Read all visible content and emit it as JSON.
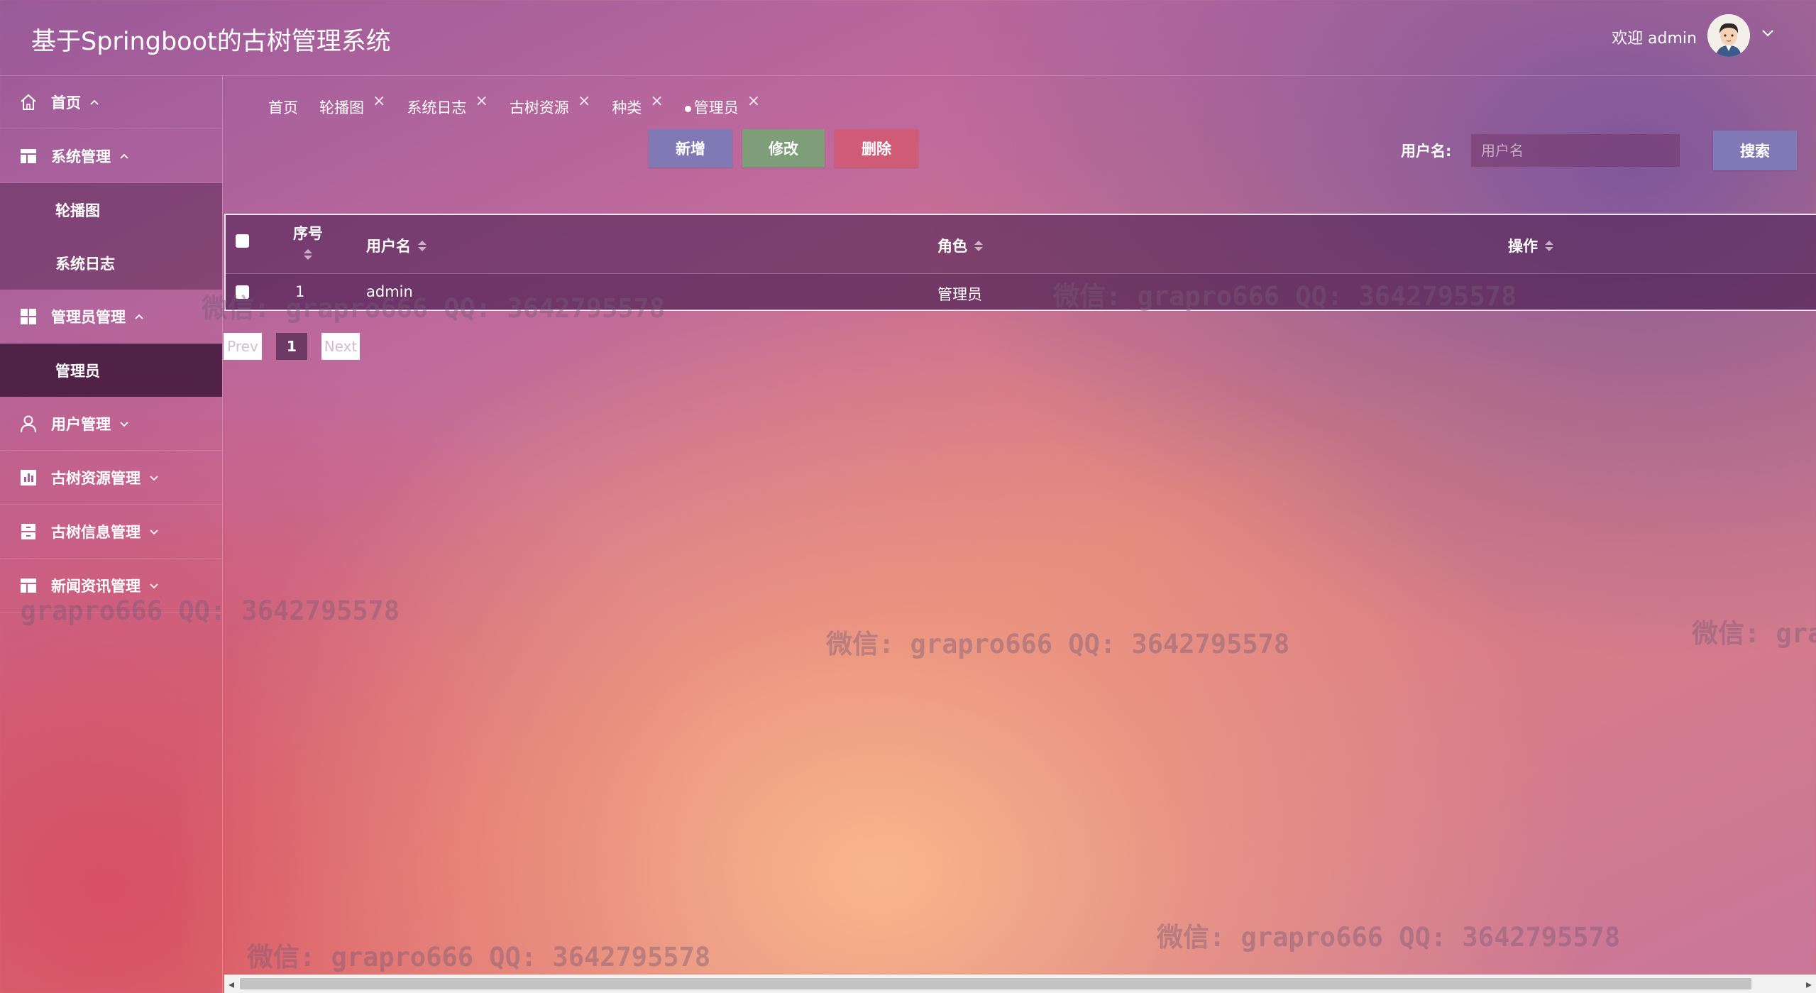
{
  "header": {
    "title": "基于Springboot的古树管理系统",
    "welcome": "欢迎 admin",
    "avatar_icon": "user-avatar-icon",
    "caret_icon": "chevron-down-icon"
  },
  "sidebar": {
    "items": [
      {
        "label": "首页",
        "icon": "home-icon",
        "expanded": true
      },
      {
        "label": "系统管理",
        "icon": "layout-icon",
        "expanded": true,
        "children": [
          {
            "label": "轮播图"
          },
          {
            "label": "系统日志"
          }
        ]
      },
      {
        "label": "管理员管理",
        "icon": "grid-icon",
        "expanded": true,
        "children": [
          {
            "label": "管理员",
            "active": true
          }
        ]
      },
      {
        "label": "用户管理",
        "icon": "user-icon",
        "expanded": false
      },
      {
        "label": "古树资源管理",
        "icon": "chart-icon",
        "expanded": false
      },
      {
        "label": "古树信息管理",
        "icon": "archive-icon",
        "expanded": false
      },
      {
        "label": "新闻资讯管理",
        "icon": "news-icon",
        "expanded": false
      }
    ]
  },
  "tabs": [
    {
      "label": "首页",
      "closable": false
    },
    {
      "label": "轮播图",
      "closable": true
    },
    {
      "label": "系统日志",
      "closable": true
    },
    {
      "label": "古树资源",
      "closable": true
    },
    {
      "label": "种类",
      "closable": true
    },
    {
      "label": "管理员",
      "closable": true,
      "active": true
    }
  ],
  "toolbar": {
    "add_label": "新增",
    "edit_label": "修改",
    "delete_label": "删除",
    "search_label": "用户名:",
    "search_placeholder": "用户名",
    "search_button": "搜索"
  },
  "table": {
    "columns": [
      "序号",
      "用户名",
      "角色",
      "操作"
    ],
    "rows": [
      {
        "index": "1",
        "username": "admin",
        "role": "管理员",
        "actions": ""
      }
    ]
  },
  "pagination": {
    "prev": "Prev",
    "current": "1",
    "next": "Next"
  },
  "watermark": "微信: grapro666 QQ: 3642795578",
  "colors": {
    "add_button": "#8079b6",
    "edit_button": "#7e9e7a",
    "delete_button": "#cf5b77",
    "search_button": "#8079b6"
  }
}
